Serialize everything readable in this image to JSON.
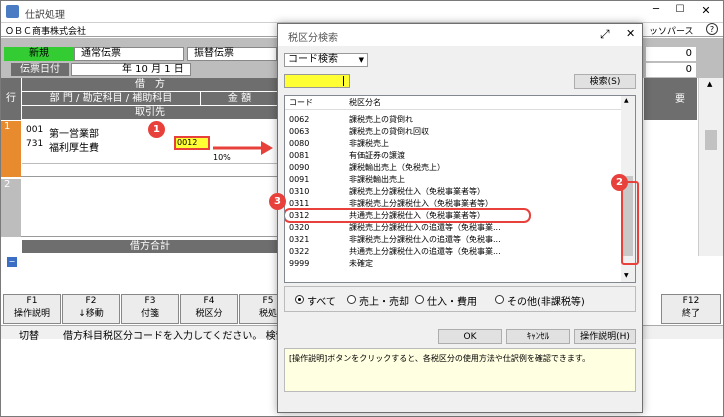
{
  "window": {
    "title": "仕訳処理",
    "company": "ＯＢＣ商事株式会社",
    "right_menu": "ッソパース"
  },
  "voucher_tabs": {
    "new": "新規",
    "normal": "通常伝票",
    "transfer": "振替伝票"
  },
  "date": {
    "label": "伝票日付",
    "value": "年 10 月 1 日"
  },
  "grid": {
    "row_header": "行",
    "debit": "借　方",
    "dept_account": "部 門 / 勘定科目 / 補助科目",
    "amount": "金 額",
    "partner": "取引先",
    "summary_col": "要",
    "rows": [
      {
        "num": "1",
        "dept_code": "001",
        "dept_name": "第一営業部",
        "acct_code": "731",
        "acct_name": "福利厚生費",
        "tax_code": "0012",
        "tax_rate": "10%"
      },
      {
        "num": "2"
      }
    ],
    "debit_total": "借方合計",
    "right_values": [
      "0",
      "0"
    ]
  },
  "fkeys": [
    {
      "key": "F1",
      "label": "操作説明"
    },
    {
      "key": "F2",
      "label": "↓移動"
    },
    {
      "key": "F3",
      "label": "付箋"
    },
    {
      "key": "F4",
      "label": "税区分"
    },
    {
      "key": "F5",
      "label": "税処"
    },
    {
      "key": "F12",
      "label": "終了"
    }
  ],
  "status": {
    "mode": "切替",
    "message": "借方科目税区分コードを入力してください。 検索"
  },
  "dialog": {
    "title": "税区分検索",
    "search_type": "コード検索",
    "search_value": "",
    "search_button": "検索(S)",
    "columns": [
      "コード",
      "税区分名"
    ],
    "rows": [
      {
        "code": "0062",
        "name": "課税売上の貸倒れ"
      },
      {
        "code": "0063",
        "name": "課税売上の貸倒れ回収"
      },
      {
        "code": "0080",
        "name": "非課税売上"
      },
      {
        "code": "0081",
        "name": "有価証券の譲渡"
      },
      {
        "code": "0090",
        "name": "課税輸出売上（免税売上）"
      },
      {
        "code": "0091",
        "name": "非課税輸出売上"
      },
      {
        "code": "0310",
        "name": "課税売上分課税仕入（免税事業者等）"
      },
      {
        "code": "0311",
        "name": "非課税売上分課税仕入（免税事業者等）"
      },
      {
        "code": "0312",
        "name": "共通売上分課税仕入（免税事業者等）"
      },
      {
        "code": "0320",
        "name": "課税売上分課税仕入の追還等（免税事業..."
      },
      {
        "code": "0321",
        "name": "非課税売上分課税仕入の追還等（免税事..."
      },
      {
        "code": "0322",
        "name": "共通売上分課税仕入の追還等（免税事業..."
      },
      {
        "code": "9999",
        "name": "未確定"
      }
    ],
    "filters": [
      "すべて",
      "売上・売却",
      "仕入・費用",
      "その他(非課税等)"
    ],
    "ok": "OK",
    "cancel": "ｷｬﾝｾﾙ",
    "help": "操作説明(H)",
    "help_text": "[操作説明]ボタンをクリックすると、各税区分の使用方法や仕訳例を確認できます。"
  },
  "callouts": [
    "1",
    "2",
    "3"
  ],
  "colors": {
    "accent_red": "#e8413b",
    "yellow": "#ffff33",
    "green": "#33cc33"
  }
}
